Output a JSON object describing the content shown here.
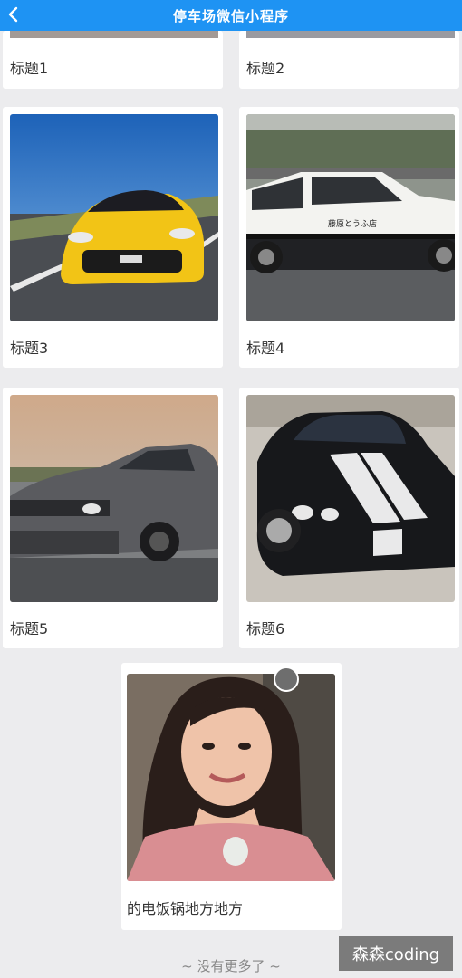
{
  "navbar": {
    "title": "停车场微信小程序",
    "back_icon": "chevron-left-icon",
    "background": "#1e93f3"
  },
  "cards": [
    {
      "label": "标题1",
      "image": "partial-image"
    },
    {
      "label": "标题2",
      "image": "partial-image"
    },
    {
      "label": "标题3",
      "image": "yellow-sports-car"
    },
    {
      "label": "标题4",
      "image": "white-black-hatchback"
    },
    {
      "label": "标题5",
      "image": "gray-muscle-car"
    },
    {
      "label": "标题6",
      "image": "black-striped-muscle-car"
    },
    {
      "label": "的电饭锅地方地方",
      "image": "woman-portrait"
    }
  ],
  "footer": {
    "text": "~ 没有更多了 ~"
  },
  "watermark": {
    "text": "森森coding"
  }
}
